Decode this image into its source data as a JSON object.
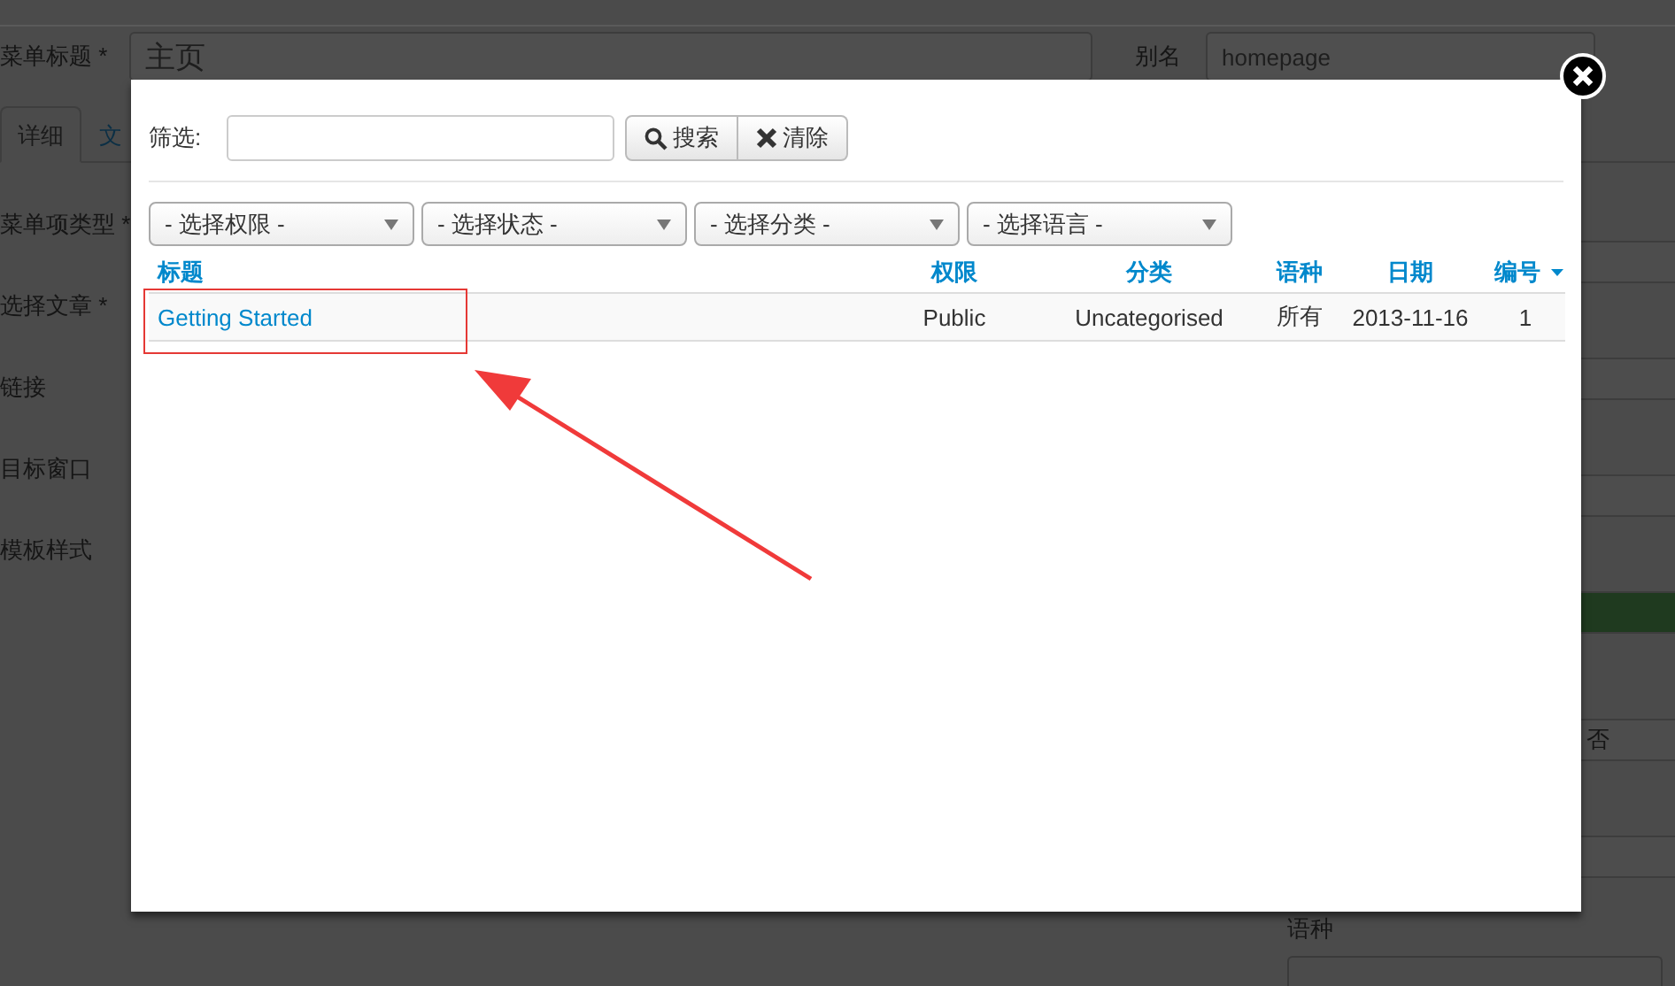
{
  "page": {
    "title_field": {
      "label": "菜单标题 *",
      "value": "主页"
    },
    "alias_field": {
      "label": "别名",
      "value": "homepage"
    },
    "tabs": [
      {
        "label": "详细",
        "selected": true
      },
      {
        "label": "文",
        "selected": false
      }
    ],
    "form_labels": [
      "菜单项类型 *",
      "选择文章 *",
      "链接",
      "目标窗口",
      "模板样式"
    ],
    "side_value": "否",
    "language_label": "语种"
  },
  "modal": {
    "filter": {
      "label": "筛选:"
    },
    "buttons": [
      {
        "label": "搜索",
        "kind": "search"
      },
      {
        "label": "清除",
        "kind": "clear"
      }
    ],
    "selects": [
      "- 选择权限 -",
      "- 选择状态 -",
      "- 选择分类 -",
      "- 选择语言 -"
    ],
    "table": {
      "columns": [
        {
          "label": "标题",
          "sorted": false
        },
        {
          "label": "权限",
          "sorted": false
        },
        {
          "label": "分类",
          "sorted": false
        },
        {
          "label": "语种",
          "sorted": false
        },
        {
          "label": "日期",
          "sorted": false
        },
        {
          "label": "编号",
          "sorted": true
        }
      ],
      "rows": [
        {
          "cells": [
            "Getting Started",
            "Public",
            "Uncategorised",
            "所有",
            "2013-11-16",
            "1"
          ]
        }
      ]
    }
  }
}
